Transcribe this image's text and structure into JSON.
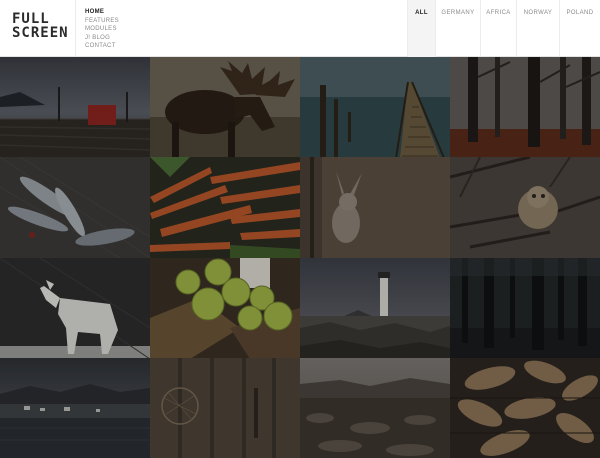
{
  "logo": {
    "line1": "FULL",
    "line2": "SCREEN"
  },
  "nav": {
    "items": [
      {
        "label": "HOME",
        "active": true
      },
      {
        "label": "FEATURES",
        "active": false
      },
      {
        "label": "MODULES",
        "active": false
      },
      {
        "label": "J! BLOG",
        "active": false
      },
      {
        "label": "CONTACT",
        "active": false
      }
    ]
  },
  "filters": {
    "items": [
      {
        "label": "ALL",
        "active": true
      },
      {
        "label": "GERMANY",
        "active": false
      },
      {
        "label": "AFRICA",
        "active": false
      },
      {
        "label": "NORWAY",
        "active": false
      },
      {
        "label": "POLAND",
        "active": false
      }
    ]
  },
  "gallery": {
    "tiles": [
      "harbor-pier-storm",
      "moose",
      "wooden-boardwalk",
      "autumn-forest",
      "fish",
      "carrots",
      "rabbit",
      "owl",
      "white-wolf",
      "green-apples",
      "lighthouse",
      "dark-forest",
      "coastal-village",
      "wooden-fence",
      "rocky-beach",
      "dried-fish"
    ]
  }
}
